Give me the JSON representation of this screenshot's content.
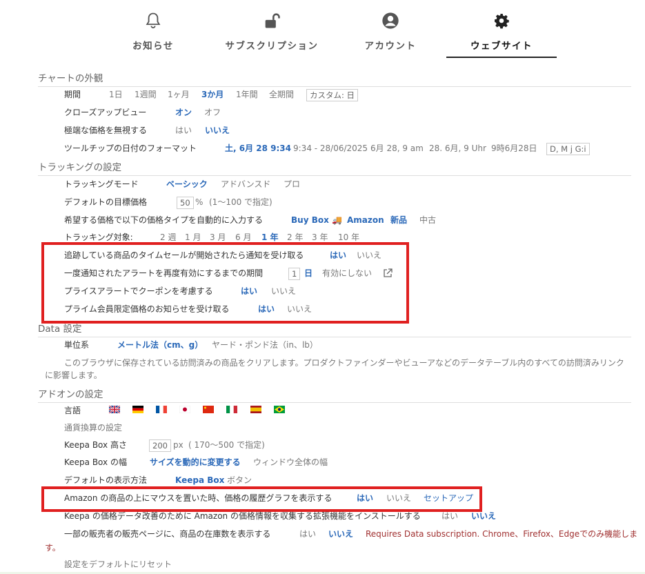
{
  "tabs": [
    {
      "label": "お知らせ",
      "icon": "bell-icon"
    },
    {
      "label": "サブスクリプション",
      "icon": "unlock-icon"
    },
    {
      "label": "アカウント",
      "icon": "account-icon"
    },
    {
      "label": "ウェブサイト",
      "icon": "gear-icon"
    }
  ],
  "chart": {
    "title": "チャートの外観",
    "period_label": "期間",
    "periods": [
      "1日",
      "1週間",
      "1ヶ月",
      "3か月",
      "1年間",
      "全期間"
    ],
    "period_custom": "カスタム: 日",
    "closeup_label": "クローズアップビュー",
    "closeup_on": "オン",
    "closeup_off": "オフ",
    "extreme_label": "極端な価格を無視する",
    "extreme_yes": "はい",
    "extreme_no": "いいえ",
    "tooltip_label": "ツールチップの日付のフォーマット",
    "tooltip_formats": [
      "土, 6月 28 9:34",
      "9:34 - 28/06/2025",
      "6月 28, 9 am",
      "28. 6月, 9 Uhr",
      "9時6月28日"
    ],
    "tooltip_custom": "D, M j G:i"
  },
  "tracking": {
    "title": "トラッキングの設定",
    "mode_label": "トラッキングモード",
    "mode_basic": "ベーシック",
    "mode_advanced": "アドバンスド",
    "mode_pro": "プロ",
    "target_label": "デフォルトの目標価格",
    "target_value": "50",
    "target_unit": "%",
    "target_hint": "(1〜100 で指定)",
    "autofill_label": "希望する価格で以下の価格タイプを自動的に入力する",
    "autofill_buybox": "Buy Box 🚚",
    "autofill_amazon": "Amazon",
    "autofill_new": "新品",
    "autofill_used": "中古",
    "duration_label": "トラッキング対象:",
    "durations": [
      "2 週",
      "1 月",
      "3 月",
      "6 月",
      "1 年",
      "2 年",
      "3 年",
      "10 年"
    ],
    "lightning_label": "追跡している商品のタイムセールが開始されたら通知を受け取る",
    "lightning_yes": "はい",
    "lightning_no": "いいえ",
    "rearm_label": "一度通知されたアラートを再度有効にするまでの期間",
    "rearm_value": "1",
    "rearm_unit": "日",
    "rearm_disable": "有効にしない",
    "coupon_label": "プライスアラートでクーポンを考慮する",
    "coupon_yes": "はい",
    "coupon_no": "いいえ",
    "prime_label": "プライム会員限定価格のお知らせを受け取る",
    "prime_yes": "はい",
    "prime_no": "いいえ"
  },
  "data": {
    "title": "Data 設定",
    "unit_label": "単位系",
    "unit_metric": "メートル法（cm、g）",
    "unit_imperial": "ヤード・ポンド法（in、lb）",
    "clear_text_1": "このブラウザに保存されている訪問済みの商品をクリアします。プロダクトファインダーやビューアなどのデータテーブル内のすべての訪問済みリンク",
    "clear_text_2": "に影響します。"
  },
  "addon": {
    "title": "アドオンの設定",
    "language_label": "言語",
    "currency_label": "通貨換算の設定",
    "height_label": "Keepa Box 高さ",
    "height_value": "200",
    "height_unit": "px",
    "height_hint": "( 170〜500 で指定)",
    "width_label": "Keepa Box の幅",
    "width_dynamic": "サイズを動的に変更する",
    "width_full": "ウィンドウ全体の幅",
    "display_label": "デフォルトの表示方法",
    "display_box": "Keepa Box",
    "display_button": "ボタン",
    "hover_label": "Amazon の商品の上にマウスを置いた時、価格の履歴グラフを表示する",
    "hover_yes": "はい",
    "hover_no": "いいえ",
    "hover_setup": "セットアップ",
    "collect_label": "Keepa の価格データ改善のために Amazon の価格情報を収集する拡張機能をインストールする",
    "collect_yes": "はい",
    "collect_no": "いいえ",
    "stock_label": "一部の販売者の販売ページに、商品の在庫数を表示する",
    "stock_yes": "はい",
    "stock_no": "いいえ",
    "stock_note_1": "Requires Data subscription. Chrome、Firefox、Edgeでのみ機能しま",
    "stock_note_2": "す。",
    "reset_label": "設定をデフォルトにリセット"
  },
  "colors": {
    "accent": "#2a68b8",
    "highlight": "#e02020",
    "warning": "#a03030"
  }
}
